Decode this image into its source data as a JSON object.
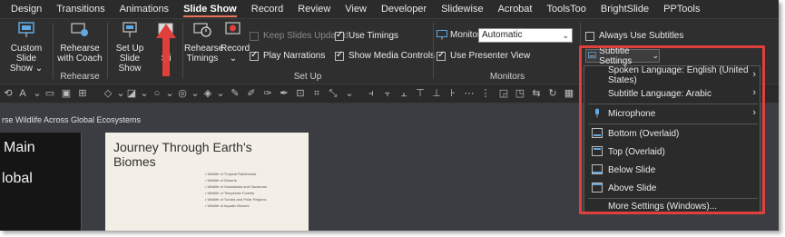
{
  "tabs": [
    "Design",
    "Transitions",
    "Animations",
    "Slide Show",
    "Record",
    "Review",
    "View",
    "Developer",
    "Slidewise",
    "Acrobat",
    "ToolsToo",
    "BrightSlide",
    "PPTools"
  ],
  "ribbon": {
    "custom_slide_show_1": "Custom Slide",
    "custom_slide_show_2": "Show ⌄",
    "rehearse_coach_1": "Rehearse",
    "rehearse_coach_2": "with Coach",
    "rehearse_group": "Rehearse",
    "setup_show_1": "Set Up",
    "setup_show_2": "Slide Show",
    "hide_slide_partial": "Sli",
    "rehearse_timings_1": "Rehearse",
    "rehearse_timings_2": "Timings",
    "record_1": "Record",
    "record_2": "⌄",
    "keep_slides_updated": "Keep Slides Updated",
    "play_narrations": "Play Narrations",
    "use_timings": "Use Timings",
    "show_media_controls": "Show Media Controls",
    "setup_group": "Set Up",
    "monitor_label": "Monitor:",
    "monitor_value": "Automatic",
    "use_presenter_view": "Use Presenter View",
    "monitors_group": "Monitors",
    "always_use_subtitles": "Always Use Subtitles",
    "subtitle_settings": "Subtitle Settings"
  },
  "presentation_title": "rse Wildlife Across Global Ecosystems",
  "slide_dark": {
    "line1": "Main",
    "line2": "lobal"
  },
  "slide_light": {
    "title_1": "Journey Through Earth's",
    "title_2": "Biomes",
    "bullets": [
      "Wildlife of Tropical Rainforests",
      "Wildlife of Deserts",
      "Wildlife of Grasslands and Savannas",
      "Wildlife of Temperate Forests",
      "Wildlife of Tundra and Polar Regions",
      "Wildlife of Aquatic Biomes"
    ]
  },
  "menu": {
    "spoken_language": "Spoken Language: English (United States)",
    "subtitle_language": "Subtitle Language: Arabic",
    "microphone": "Microphone",
    "bottom_overlaid": "Bottom (Overlaid)",
    "top_overlaid": "Top (Overlaid)",
    "below_slide": "Below Slide",
    "above_slide": "Above Slide",
    "more_settings": "More Settings (Windows)..."
  },
  "colors": {
    "highlight": "#e0403c",
    "arrow": "#e0403c",
    "active_tab_underline": "#e8725a"
  }
}
